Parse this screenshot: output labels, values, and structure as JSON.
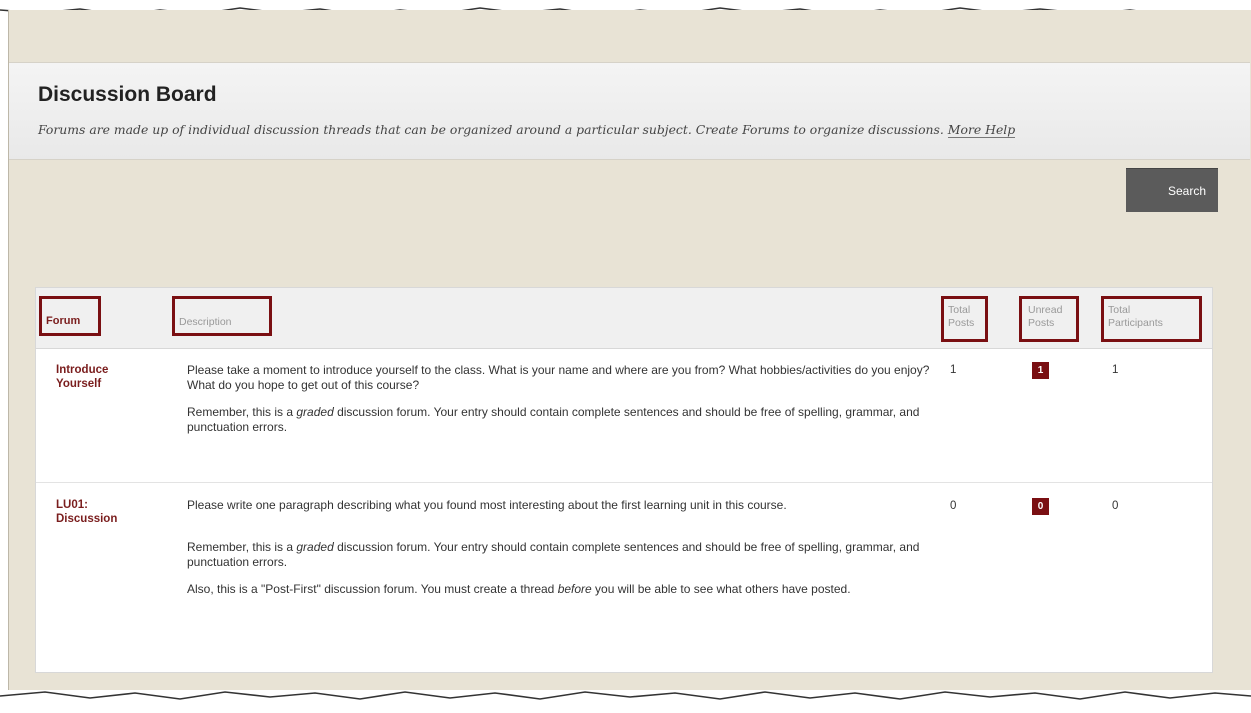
{
  "page": {
    "title": "Discussion Board",
    "description": "Forums are made up of individual discussion threads that can be organized around a particular subject. Create Forums to organize discussions.",
    "more_help": "More Help"
  },
  "toolbar": {
    "search_label": "Search"
  },
  "table": {
    "headers": {
      "forum": "Forum",
      "description": "Description",
      "total_posts_1": "Total",
      "total_posts_2": "Posts",
      "unread_posts_1": "Unread",
      "unread_posts_2": "Posts",
      "total_participants_1": "Total",
      "total_participants_2": "Participants"
    },
    "rows": [
      {
        "forum_1": "Introduce",
        "forum_2": "Yourself",
        "desc_1": "Please take a moment to introduce yourself to the class. What is your name and where are you from? What hobbies/activities do you enjoy? What do you hope to get out of this course?",
        "desc_2_pre": "Remember, this is a ",
        "desc_2_em": "graded",
        "desc_2_post": " discussion forum. Your entry should contain complete sentences and should be free of spelling, grammar, and punctuation errors.",
        "total_posts": "1",
        "unread_posts": "1",
        "total_participants": "1"
      },
      {
        "forum_1": "LU01:",
        "forum_2": "Discussion",
        "desc_1": "Please write one paragraph describing what you found most interesting about the first learning unit in this course.",
        "desc_2_pre": "Remember, this is a ",
        "desc_2_em": "graded",
        "desc_2_post": " discussion forum. Your entry should contain complete sentences and should be free of spelling, grammar, and punctuation errors.",
        "desc_3_pre": "Also, this is a \"Post-First\" discussion forum. You must create a thread ",
        "desc_3_em": "before",
        "desc_3_post": " you will be able to see what others have posted.",
        "total_posts": "0",
        "unread_posts": "0",
        "total_participants": "0"
      }
    ]
  },
  "colors": {
    "accent": "#7a0f12",
    "frame_bg": "#e8e3d5",
    "search_bg": "#5b5b5b"
  }
}
